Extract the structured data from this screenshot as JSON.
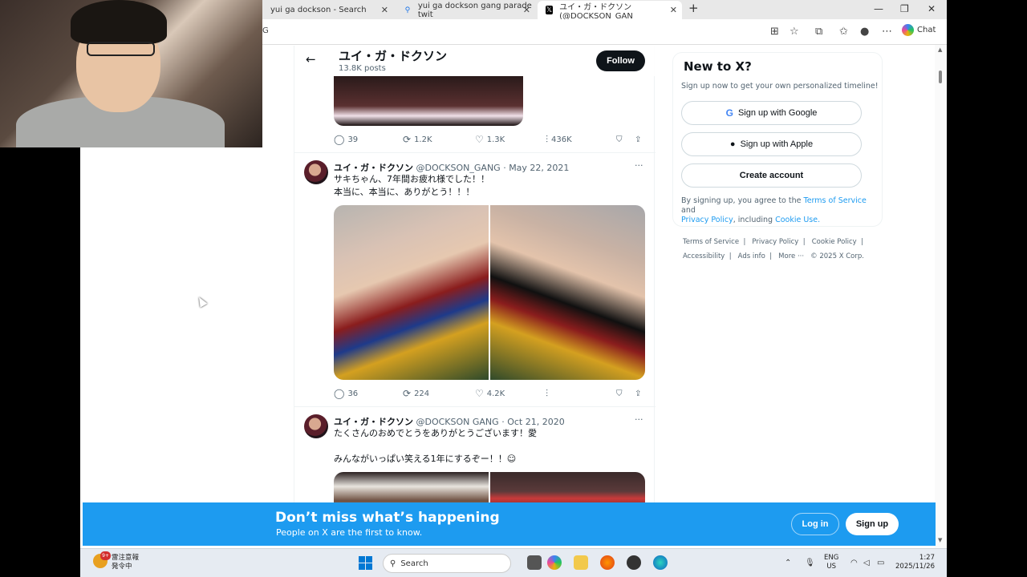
{
  "browser": {
    "tabs": [
      {
        "label": "yui ga dockson - Search",
        "active": false
      },
      {
        "label": "yui ga dockson gang parade twit",
        "active": false
      },
      {
        "label": "ユイ・ガ・ドクソン (@DOCKSON_GAN",
        "active": true
      }
    ],
    "address_fragment": "G",
    "chat_label": "Chat"
  },
  "header": {
    "name": "ユイ・ガ・ドクソン",
    "posts": "13.8K posts",
    "follow_label": "Follow"
  },
  "first_tweet_actions": {
    "replies": "39",
    "reposts": "1.2K",
    "likes": "1.3K",
    "views": "436K"
  },
  "tweets": [
    {
      "name": "ユイ・ガ・ドクソン",
      "handle": "@DOCKSON_GANG",
      "date": "· May 22, 2021",
      "text": "サキちゃん、7年間お疲れ様でした！！\n本当に、本当に、ありがとう！！！",
      "replies": "36",
      "reposts": "224",
      "likes": "4.2K",
      "views": ""
    },
    {
      "name": "ユイ・ガ・ドクソン",
      "handle": "@DOCKSON GANG",
      "date": "· Oct 21, 2020",
      "text": "たくさんのおめでとうをありがとうございます！愛\n\nみんながいっぱい笑える1年にするぞー！！☺"
    }
  ],
  "sidebar": {
    "title": "New to X?",
    "subtitle": "Sign up now to get your own personalized timeline!",
    "google_label": "Sign up with Google",
    "apple_label": "Sign up with Apple",
    "create_label": "Create account",
    "legal_1": "By signing up, you agree to the ",
    "terms": "Terms of Service",
    "legal_2": " and",
    "privacy": "Privacy Policy",
    "legal_3": ", including ",
    "cookie": "Cookie Use.",
    "footer_row1": "Terms of Service  |   Privacy Policy  |   Cookie Policy  |",
    "footer_row2": "Accessibility  |   Ads info  |   More ···   © 2025 X Corp."
  },
  "banner": {
    "title": "Don’t miss what’s happening",
    "subtitle": "People on X are the first to know.",
    "login_label": "Log in",
    "signup_label": "Sign up"
  },
  "taskbar": {
    "weather_title": "雷注意報",
    "weather_sub": "発令中",
    "weather_badge": "9+",
    "search_label": "Search",
    "lang_1": "ENG",
    "lang_2": "US",
    "time": "1:27",
    "date": "2025/11/26"
  }
}
